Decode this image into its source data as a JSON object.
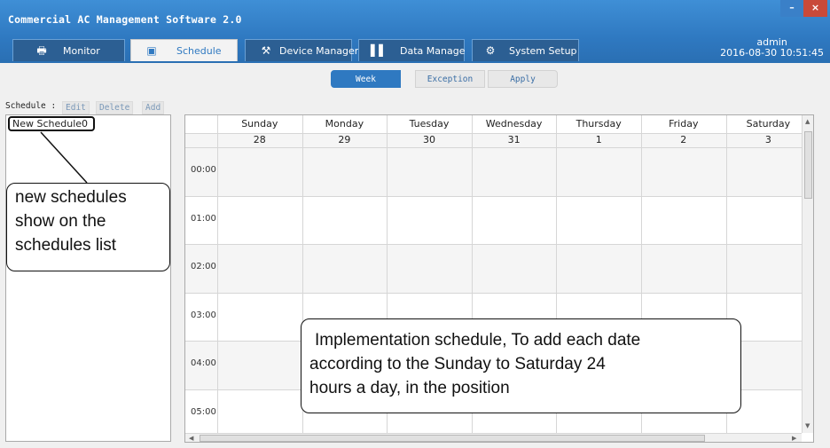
{
  "app": {
    "title": "Commercial AC Management Software 2.0"
  },
  "window": {
    "minimize_label": "–",
    "close_label": "×"
  },
  "tabs": [
    {
      "label": "Monitor",
      "icon": "printer-icon"
    },
    {
      "label": "Schedule",
      "icon": "calendar-icon"
    },
    {
      "label": "Device Manager",
      "icon": "wrench-icon"
    },
    {
      "label": "Data Manage",
      "icon": "bar-chart-icon"
    },
    {
      "label": "System Setup",
      "icon": "gear-icon"
    }
  ],
  "user": {
    "name": "admin",
    "datetime": "2016-08-30 10:51:45"
  },
  "views": {
    "week": "Week",
    "exception": "Exception",
    "apply": "Apply"
  },
  "schedule_panel": {
    "label": "Schedule :",
    "edit": "Edit",
    "delete": "Delete",
    "add": "Add",
    "items": [
      "New Schedule0"
    ]
  },
  "calendar": {
    "days": [
      {
        "name": "Sunday",
        "date": "28"
      },
      {
        "name": "Monday",
        "date": "29"
      },
      {
        "name": "Tuesday",
        "date": "30"
      },
      {
        "name": "Wednesday",
        "date": "31"
      },
      {
        "name": "Thursday",
        "date": "1"
      },
      {
        "name": "Friday",
        "date": "2"
      },
      {
        "name": "Saturday",
        "date": "3"
      }
    ],
    "times": [
      "00:00",
      "01:00",
      "02:00",
      "03:00",
      "04:00",
      "05:00"
    ]
  },
  "callouts": {
    "left": [
      "new schedules",
      "show on the",
      "schedules list"
    ],
    "main": [
      "Implementation schedule, To add each date",
      "according to the Sunday to Saturday 24",
      "hours a day, in the position"
    ]
  },
  "colors": {
    "titlebar": "#2f79c1",
    "tab_inactive": "#2c5f93",
    "accent": "#2f79c1",
    "close": "#c94a3a"
  }
}
